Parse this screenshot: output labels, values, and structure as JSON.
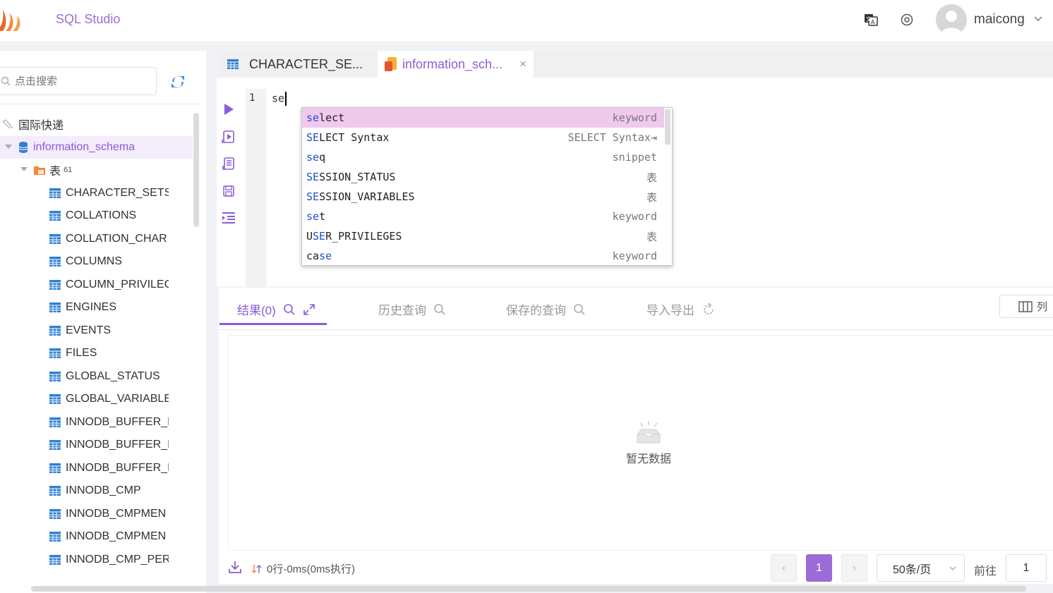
{
  "header": {
    "app_title": "SQL Studio",
    "username": "maicong"
  },
  "sidebar": {
    "search_placeholder": "点击搜索",
    "tree": {
      "connection": "国际快递",
      "database": "information_schema",
      "tables_folder": "表",
      "tables_count": "61",
      "tables": [
        "CHARACTER_SETS",
        "COLLATIONS",
        "COLLATION_CHAR",
        "COLUMNS",
        "COLUMN_PRIVILEC",
        "ENGINES",
        "EVENTS",
        "FILES",
        "GLOBAL_STATUS",
        "GLOBAL_VARIABLE",
        "INNODB_BUFFER_I",
        "INNODB_BUFFER_I",
        "INNODB_BUFFER_I",
        "INNODB_CMP",
        "INNODB_CMPMEN",
        "INNODB_CMPMEN",
        "INNODB_CMP_PER"
      ]
    }
  },
  "tabs": [
    {
      "label": "CHARACTER_SE..."
    },
    {
      "label": "information_sch...",
      "close": "×"
    }
  ],
  "editor": {
    "line_number": "1",
    "code": "se"
  },
  "autocomplete": [
    {
      "match": "se",
      "rest": "lect",
      "type": "keyword"
    },
    {
      "match": "SE",
      "rest": "LECT Syntax",
      "type": "SELECT Syntax⇥"
    },
    {
      "match": "se",
      "rest": "q",
      "type": "snippet"
    },
    {
      "match": "SE",
      "rest": "SSION_STATUS",
      "type": "表"
    },
    {
      "match": "SE",
      "rest": "SSION_VARIABLES",
      "type": "表"
    },
    {
      "match": "se",
      "rest": "t",
      "type": "keyword"
    },
    {
      "prefix": "U",
      "match": "SE",
      "rest": "R_PRIVILEGES",
      "type": "表"
    },
    {
      "prefix": "ca",
      "match": "se",
      "rest": "",
      "type": "keyword"
    }
  ],
  "results": {
    "tabs": [
      "结果(0)",
      "历史查询",
      "保存的查询",
      "导入导出"
    ],
    "columns_button": "列",
    "empty_text": "暂无数据",
    "stats": "0行-0ms(0ms执行)",
    "pagination": {
      "prev": "‹",
      "current_page": "1",
      "next": "›",
      "page_size": "50条/页",
      "goto_label": "前往",
      "goto_value": "1"
    }
  },
  "colors": {
    "accent": "#8b5cd6",
    "selected_suggestion": "#f0c9ec",
    "table_icon": "#2f7fd6"
  }
}
